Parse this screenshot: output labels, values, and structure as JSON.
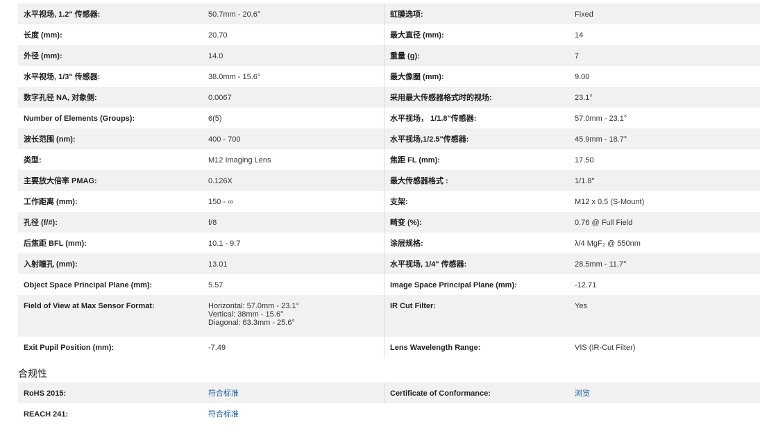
{
  "specs": [
    {
      "l1": "水平视场, 1.2\" 传感器:",
      "v1": "50.7mm - 20.6°",
      "l2": "虹膜选项:",
      "v2": "Fixed"
    },
    {
      "l1": "长度 (mm):",
      "v1": "20.70",
      "l2": "最大直径 (mm):",
      "v2": "14"
    },
    {
      "l1": "外径 (mm):",
      "v1": "14.0",
      "l2": "重量 (g):",
      "v2": "7"
    },
    {
      "l1": "水平视场, 1/3\" 传感器:",
      "v1": "38.0mm - 15.6°",
      "l2": "最大像圈 (mm):",
      "v2": "9.00"
    },
    {
      "l1": "数字孔径 NA, 对象侧:",
      "v1": "0.0067",
      "l2": "采用最大传感器格式时的视场:",
      "v2": "23.1°"
    },
    {
      "l1": "Number of Elements (Groups):",
      "v1": "6(5)",
      "l2": "水平视场， 1/1.8\"传感器:",
      "v2": "57.0mm - 23.1°"
    },
    {
      "l1": "波长范围 (nm):",
      "v1": "400 - 700",
      "l2": "水平视场,1/2.5\"传感器:",
      "v2": "45.9mm - 18.7°"
    },
    {
      "l1": "类型:",
      "v1": "M12 Imaging Lens",
      "l2": "焦距 FL (mm):",
      "v2": "17.50"
    },
    {
      "l1": "主要放大倍率 PMAG:",
      "v1": "0.126X",
      "l2": "最大传感器格式 :",
      "v2": "1/1.8\""
    },
    {
      "l1": "工作距离 (mm):",
      "v1": "150 - ∞",
      "l2": "支架:",
      "v2": "M12 x 0.5 (S-Mount)"
    },
    {
      "l1": "孔径 (f/#):",
      "v1": "f/8",
      "l2": "畸变 (%):",
      "v2": "0.76 @ Full Field"
    },
    {
      "l1": "后焦距 BFL (mm):",
      "v1": "10.1 - 9.7",
      "l2": "涂层规格:",
      "v2": "λ/4 MgF₂ @ 550nm"
    },
    {
      "l1": "入射瞳孔 (mm):",
      "v1": "13.01",
      "l2": "水平视场, 1/4\" 传感器:",
      "v2": "28.5mm - 11.7°"
    },
    {
      "l1": "Object Space Principal Plane (mm):",
      "v1": "5.57",
      "l2": "Image Space Principal Plane (mm):",
      "v2": "-12.71"
    },
    {
      "l1": "Exit Pupil Position (mm):",
      "v1": "-7.49",
      "l2": "Lens Wavelength Range:",
      "v2": "VIS (IR-Cut Filter)"
    }
  ],
  "fov_row": {
    "l1": "Field of View at Max Sensor Format:",
    "v1_lines": [
      "Horizontal: 57.0mm - 23.1°",
      "Vertical: 38mm - 15.6°",
      "Diagonal: 63.3mm - 25.6°"
    ],
    "l2": "IR Cut Filter:",
    "v2": "Yes"
  },
  "compliance": {
    "title": "合规性",
    "rows": [
      {
        "l1": "RoHS 2015:",
        "v1": "符合标准",
        "l2": "Certificate of Conformance:",
        "v2": "浏览"
      },
      {
        "l1": "REACH 241:",
        "v1": "符合标准",
        "l2": "",
        "v2": ""
      }
    ]
  }
}
